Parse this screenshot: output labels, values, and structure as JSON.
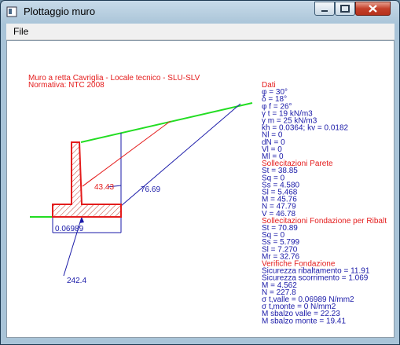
{
  "window": {
    "title": "Plottaggio muro"
  },
  "menu": {
    "file_label": "File"
  },
  "header": {
    "line1": "Muro a retta Cavriglia - Locale tecnico - SLU-SLV",
    "line2": "Normativa: NTC 2008"
  },
  "dim_labels": {
    "red_value": "43.43",
    "blue_value": "76.69",
    "base_value": "0.06989",
    "bottom_value": "242.4"
  },
  "panel": [
    {
      "text": "Dati",
      "color": "red"
    },
    {
      "text": "φ = 30°",
      "color": "blue"
    },
    {
      "text": "δ = 18°",
      "color": "blue"
    },
    {
      "text": "φ f = 26°",
      "color": "blue"
    },
    {
      "text": "γ t = 19 kN/m3",
      "color": "blue"
    },
    {
      "text": "γ m = 25 kN/m3",
      "color": "blue"
    },
    {
      "text": "kh = 0.0364; kv = 0.0182",
      "color": "blue"
    },
    {
      "text": "Nl = 0",
      "color": "blue"
    },
    {
      "text": "dN = 0",
      "color": "blue"
    },
    {
      "text": "Vl = 0",
      "color": "blue"
    },
    {
      "text": "Ml = 0",
      "color": "blue"
    },
    {
      "text": "Sollecitazioni Parete",
      "color": "red"
    },
    {
      "text": "St = 38.85",
      "color": "blue"
    },
    {
      "text": "Sq = 0",
      "color": "blue"
    },
    {
      "text": "Ss = 4.580",
      "color": "blue"
    },
    {
      "text": "Sl = 5.468",
      "color": "blue"
    },
    {
      "text": "M = 45.76",
      "color": "blue"
    },
    {
      "text": "N = 47.79",
      "color": "blue"
    },
    {
      "text": "V = 46.78",
      "color": "blue"
    },
    {
      "text": "Sollecitazioni Fondazione per Ribalt",
      "color": "red"
    },
    {
      "text": "St = 70.89",
      "color": "blue"
    },
    {
      "text": "Sq = 0",
      "color": "blue"
    },
    {
      "text": "Ss = 5.799",
      "color": "blue"
    },
    {
      "text": "Sl = 7.270",
      "color": "blue"
    },
    {
      "text": "Mr = 32.76",
      "color": "blue"
    },
    {
      "text": "Verifiche Fondazione",
      "color": "red"
    },
    {
      "text": "Sicurezza ribaltamento = 11.91",
      "color": "blue"
    },
    {
      "text": "Sicurezza scorrimento = 1.069",
      "color": "blue"
    },
    {
      "text": "M = 4.562",
      "color": "blue"
    },
    {
      "text": "N = 227.8",
      "color": "blue"
    },
    {
      "text": "σ t,valle = 0.06989 N/mm2",
      "color": "blue"
    },
    {
      "text": "σ t,monte = 0 N/mm2",
      "color": "blue"
    },
    {
      "text": "M sbalzo valle = 22.23",
      "color": "blue"
    },
    {
      "text": "M sbalzo monte = 19.41",
      "color": "blue"
    }
  ],
  "colors": {
    "red": "#e41c1c",
    "blue": "#1a1aa8",
    "green": "#22dd22",
    "hatch": "#c0392b"
  }
}
